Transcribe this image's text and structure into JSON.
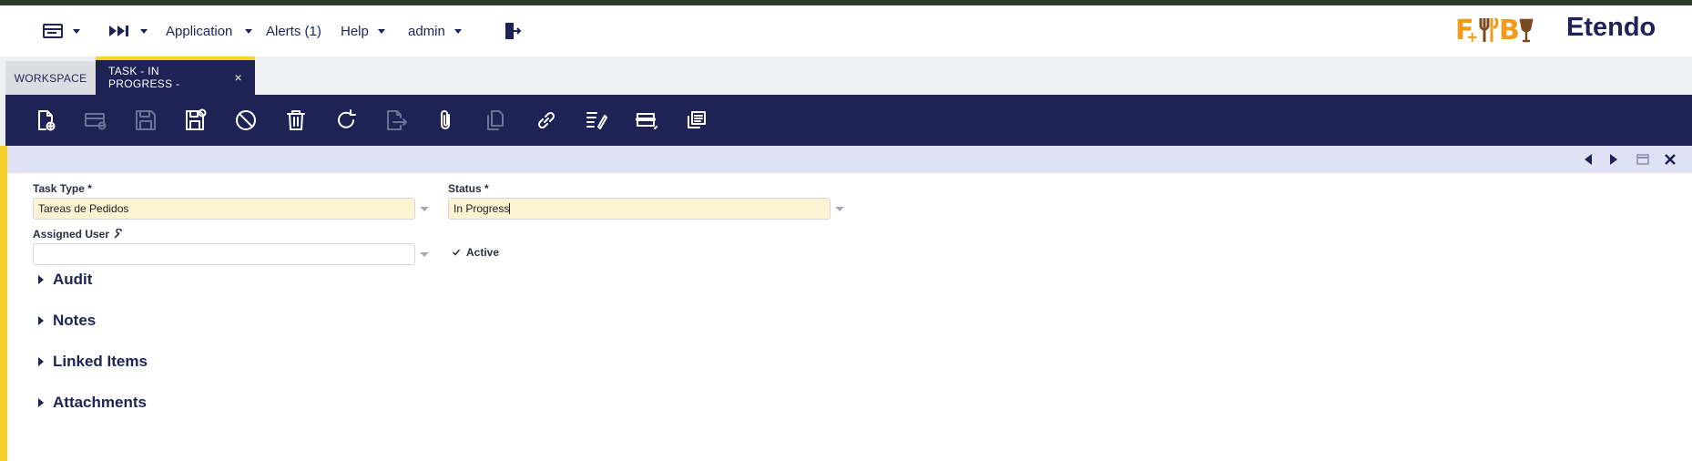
{
  "topbar": {
    "application_label": "Application",
    "alerts_label": "Alerts (1)",
    "help_label": "Help",
    "user_label": "admin",
    "brand_logo_text": "F&B",
    "brand_name": "Etendo"
  },
  "tabs": {
    "workspace_label": "WORKSPACE",
    "active_label": "TASK - IN PROGRESS -",
    "close_glyph": "×"
  },
  "toolbar": {
    "icons": [
      "new-document-icon",
      "new-row-icon",
      "save-icon",
      "save-close-icon",
      "undo-icon",
      "delete-icon",
      "refresh-icon",
      "export-icon",
      "attachment-icon",
      "copy-record-icon",
      "link-icon",
      "audit-icon",
      "grid-view-icon",
      "clone-icon"
    ]
  },
  "form": {
    "task_type_label": "Task Type *",
    "task_type_value": "Tareas de Pedidos",
    "status_label": "Status *",
    "status_value": "In Progress",
    "assigned_user_label": "Assigned User",
    "assigned_user_value": "",
    "active_label": "Active",
    "active_checked": true
  },
  "sections": {
    "audit": "Audit",
    "notes": "Notes",
    "linked_items": "Linked Items",
    "attachments": "Attachments"
  },
  "colors": {
    "navy": "#1e2356",
    "accent_yellow": "#f3d02c",
    "required_field_bg": "#fbf3d1",
    "info_bar": "#dfe1f4",
    "logo_orange": "#f29a1b",
    "logo_brown": "#7a4a1f"
  }
}
